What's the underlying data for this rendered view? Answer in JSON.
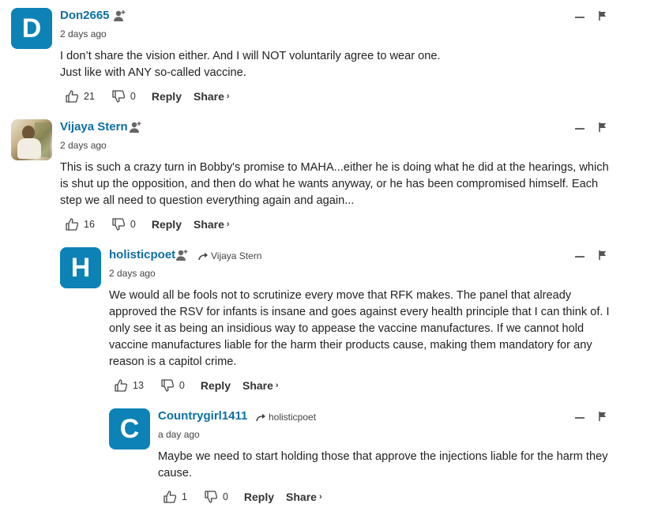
{
  "colors": {
    "accent": "#0c82b6",
    "username": "#0c6fa3"
  },
  "comments": [
    {
      "avatar_letter": "D",
      "username": "Don2665",
      "reply_to": "",
      "timestamp": "2 days ago",
      "lines": [
        "I don’t share the vision either. And I will NOT voluntarily agree to wear one.",
        "Just like with ANY so-called vaccine."
      ],
      "likes": "21",
      "dislikes": "0",
      "reply_label": "Reply",
      "share_label": "Share"
    },
    {
      "avatar_letter": "",
      "username": "Vijaya Stern",
      "reply_to": "",
      "timestamp": "2 days ago",
      "lines": [
        "This is such a crazy turn in Bobby's promise to MAHA...either he is doing what he did at the hearings, which",
        "is shut up the opposition, and then do what he wants anyway, or he has been compromised himself. Each",
        "step we all need to question everything again and again..."
      ],
      "likes": "16",
      "dislikes": "0",
      "reply_label": "Reply",
      "share_label": "Share"
    },
    {
      "avatar_letter": "H",
      "username": "holisticpoet",
      "reply_to": "Vijaya Stern",
      "timestamp": "2 days ago",
      "lines": [
        "We would all be fools not to scrutinize every move that RFK makes. The panel that already",
        "approved the RSV for infants is insane and goes against every health principle that I can think of. I",
        "only see it as being an insidious way to appease the vaccine manufactures. If we cannot hold",
        "vaccine manufactures liable for the harm their products cause, making them mandatory for any",
        "reason is a capitol crime."
      ],
      "likes": "13",
      "dislikes": "0",
      "reply_label": "Reply",
      "share_label": "Share"
    },
    {
      "avatar_letter": "C",
      "username": "Countrygirl1411",
      "reply_to": "holisticpoet",
      "timestamp": "a day ago",
      "lines": [
        "Maybe we need to start holding those that approve the injections liable for the harm they",
        "cause."
      ],
      "likes": "1",
      "dislikes": "0",
      "reply_label": "Reply",
      "share_label": "Share"
    }
  ]
}
